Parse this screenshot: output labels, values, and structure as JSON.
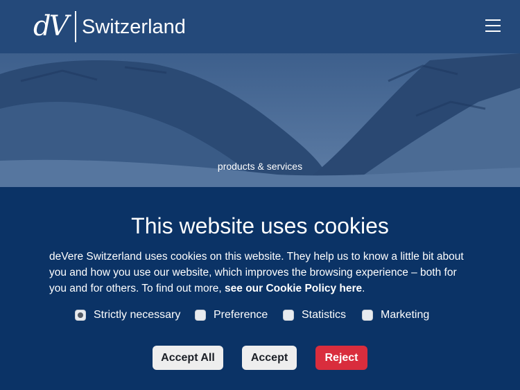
{
  "header": {
    "logo_mark": "dV",
    "logo_text": "Switzerland",
    "menu_icon": "hamburger-menu-icon"
  },
  "hero": {
    "caption": "products & services"
  },
  "cookie": {
    "title": "This website uses cookies",
    "text_before_link": "deVere Switzerland uses cookies on this website. They help us to know a little bit about you and how you use our website, which improves the browsing experience – both for you and for others. To find out more, ",
    "link_text": "see our Cookie Policy here",
    "text_after_link": ".",
    "options": [
      {
        "label": "Strictly necessary",
        "checked": true
      },
      {
        "label": "Preference",
        "checked": false
      },
      {
        "label": "Statistics",
        "checked": false
      },
      {
        "label": "Marketing",
        "checked": false
      }
    ],
    "buttons": {
      "accept_all": "Accept All",
      "accept": "Accept",
      "reject": "Reject"
    }
  },
  "colors": {
    "header_bg": "#24497a",
    "panel_bg": "#0b3366",
    "reject_red": "#d92d3d"
  }
}
